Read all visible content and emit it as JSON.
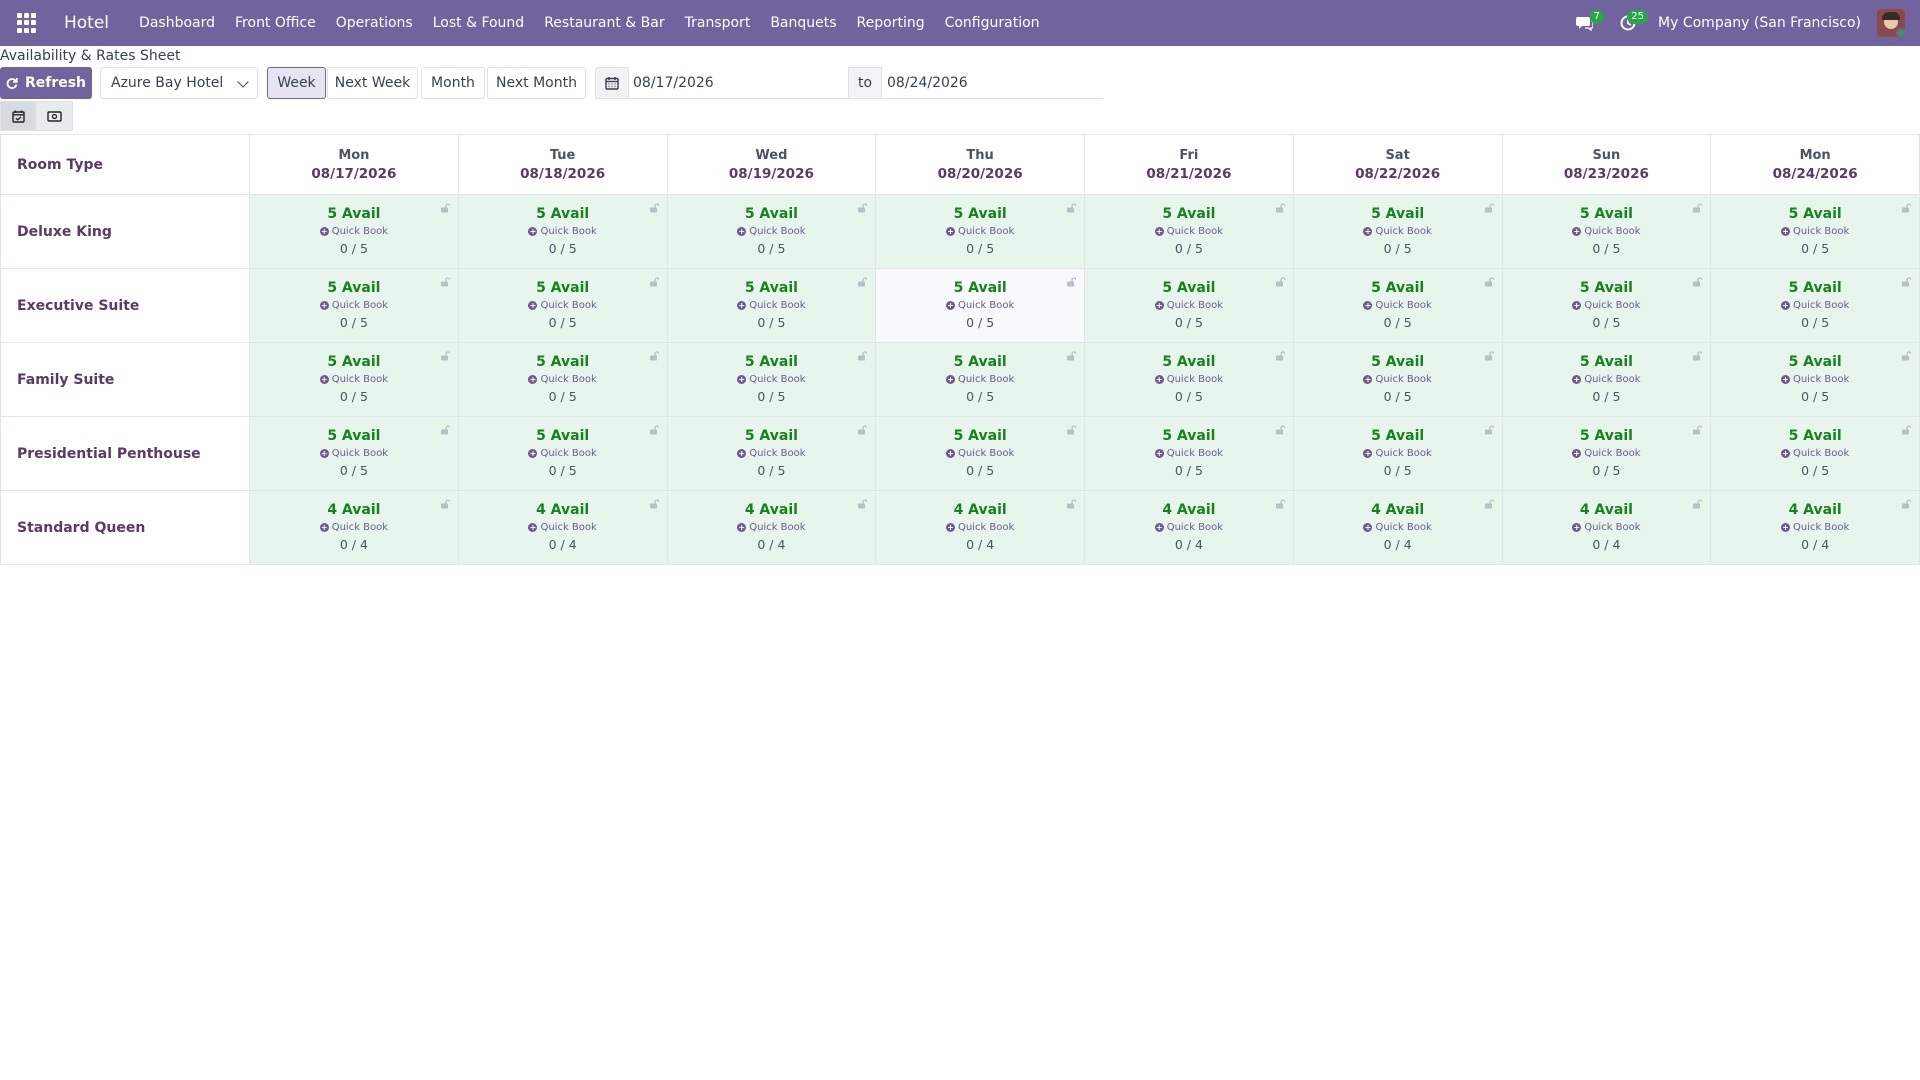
{
  "navbar": {
    "brand": "Hotel",
    "menu": [
      "Dashboard",
      "Front Office",
      "Operations",
      "Lost & Found",
      "Restaurant & Bar",
      "Transport",
      "Banquets",
      "Reporting",
      "Configuration"
    ],
    "messages_count": "7",
    "activities_count": "25",
    "company": "My Company (San Francisco)"
  },
  "page": {
    "title": "Availability & Rates Sheet"
  },
  "toolbar": {
    "refresh_label": "Refresh",
    "hotel": "Azure Bay Hotel",
    "ranges": [
      "Week",
      "Next Week",
      "Month",
      "Next Month"
    ],
    "active_range": "Week",
    "date_from": "08/17/2026",
    "to_label": "to",
    "date_to": "08/24/2026"
  },
  "grid": {
    "room_type_header": "Room Type",
    "days": [
      {
        "name": "Mon",
        "date": "08/17/2026"
      },
      {
        "name": "Tue",
        "date": "08/18/2026"
      },
      {
        "name": "Wed",
        "date": "08/19/2026"
      },
      {
        "name": "Thu",
        "date": "08/20/2026"
      },
      {
        "name": "Fri",
        "date": "08/21/2026"
      },
      {
        "name": "Sat",
        "date": "08/22/2026"
      },
      {
        "name": "Sun",
        "date": "08/23/2026"
      },
      {
        "name": "Mon",
        "date": "08/24/2026"
      }
    ],
    "quick_book_label": "Quick Book",
    "rooms": [
      {
        "name": "Deluxe King",
        "avail": "5 Avail",
        "occupancy": "0 / 5"
      },
      {
        "name": "Executive Suite",
        "avail": "5 Avail",
        "occupancy": "0 / 5"
      },
      {
        "name": "Family Suite",
        "avail": "5 Avail",
        "occupancy": "0 / 5"
      },
      {
        "name": "Presidential Penthouse",
        "avail": "5 Avail",
        "occupancy": "0 / 5"
      },
      {
        "name": "Standard Queen",
        "avail": "4 Avail",
        "occupancy": "0 / 4"
      }
    ]
  }
}
